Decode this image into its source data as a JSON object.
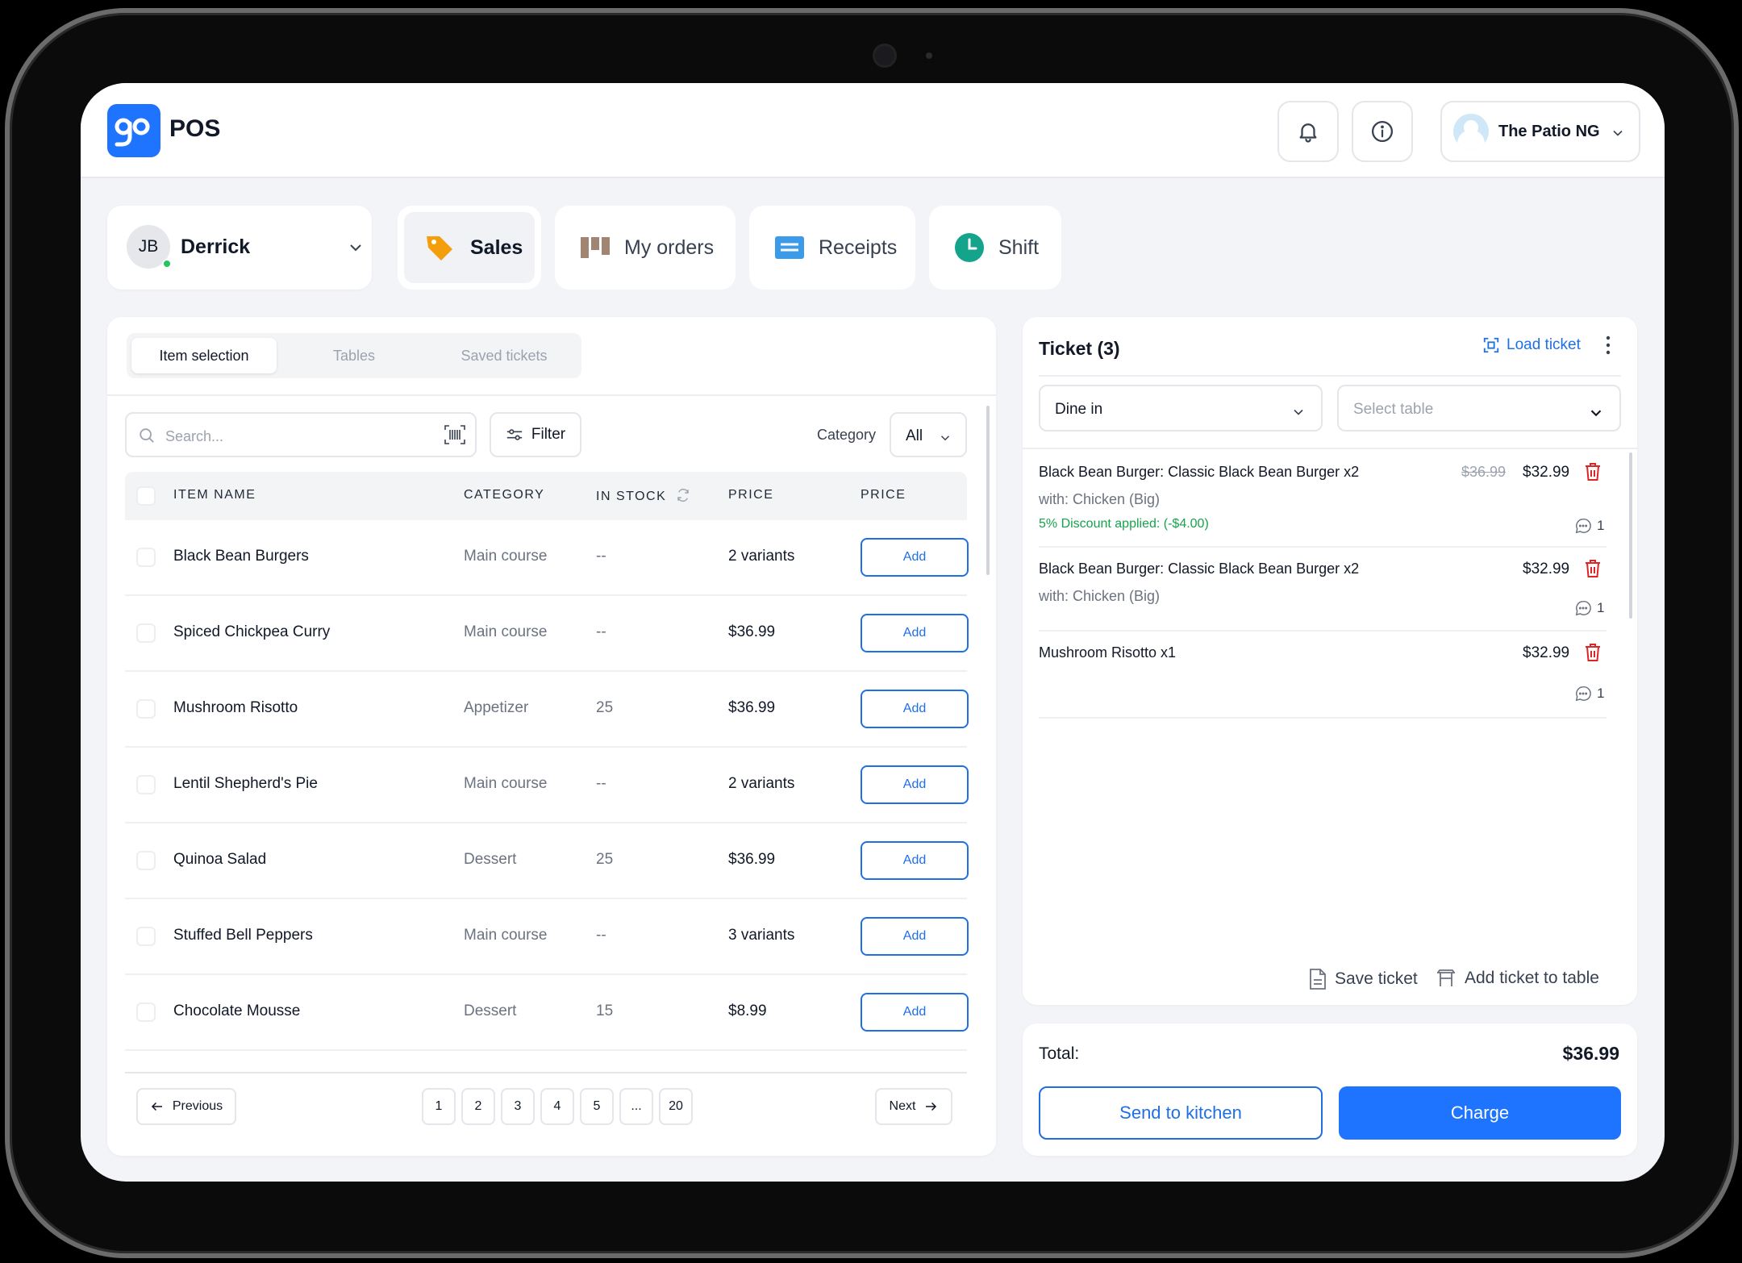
{
  "app": {
    "brand": "POS"
  },
  "header": {
    "venue": "The Patio NG"
  },
  "user": {
    "initials": "JB",
    "name": "Derrick"
  },
  "nav": [
    {
      "label": "Sales",
      "icon": "tag-icon"
    },
    {
      "label": "My orders",
      "icon": "orders-icon"
    },
    {
      "label": "Receipts",
      "icon": "receipt-icon"
    },
    {
      "label": "Shift",
      "icon": "clock-icon"
    }
  ],
  "tabs": [
    "Item selection",
    "Tables",
    "Saved tickets"
  ],
  "search": {
    "placeholder": "Search..."
  },
  "filter": {
    "label": "Filter"
  },
  "category": {
    "label": "Category",
    "value": "All"
  },
  "table": {
    "headers": [
      "ITEM NAME",
      "CATEGORY",
      "IN STOCK",
      "PRICE",
      "PRICE"
    ],
    "add_label": "Add",
    "rows": [
      {
        "name": "Black Bean Burgers",
        "category": "Main course",
        "stock": "--",
        "price": "2 variants"
      },
      {
        "name": "Spiced Chickpea Curry",
        "category": "Main course",
        "stock": "--",
        "price": "$36.99"
      },
      {
        "name": "Mushroom Risotto",
        "category": "Appetizer",
        "stock": "25",
        "price": "$36.99"
      },
      {
        "name": "Lentil Shepherd's Pie",
        "category": "Main course",
        "stock": "--",
        "price": "2 variants"
      },
      {
        "name": "Quinoa Salad",
        "category": "Dessert",
        "stock": "25",
        "price": "$36.99"
      },
      {
        "name": "Stuffed Bell Peppers",
        "category": "Main course",
        "stock": "--",
        "price": "3 variants"
      },
      {
        "name": "Chocolate Mousse",
        "category": "Dessert",
        "stock": "15",
        "price": "$8.99"
      }
    ]
  },
  "pagination": {
    "previous": "Previous",
    "next": "Next",
    "pages": [
      "1",
      "2",
      "3",
      "4",
      "5",
      "...",
      "20"
    ]
  },
  "ticket": {
    "title": "Ticket (3)",
    "load_label": "Load ticket",
    "order_type": "Dine in",
    "table_placeholder": "Select table",
    "items": [
      {
        "name": "Black Bean Burger: Classic Black Bean Burger x2",
        "with": "with: Chicken (Big)",
        "discount": "5% Discount applied: (-$4.00)",
        "old_price": "$36.99",
        "price": "$32.99",
        "notes": "1"
      },
      {
        "name": "Black Bean Burger: Classic Black Bean Burger x2",
        "with": "with: Chicken (Big)",
        "price": "$32.99",
        "notes": "1"
      },
      {
        "name": "Mushroom Risotto x1",
        "price": "$32.99",
        "notes": "1"
      }
    ],
    "save_label": "Save ticket",
    "add_table_label": "Add ticket to table"
  },
  "totals": {
    "label": "Total:",
    "value": "$36.99"
  },
  "actions": {
    "send": "Send to kitchen",
    "charge": "Charge"
  },
  "colors": {
    "accent": "#1f74ff",
    "discount": "#16a34a",
    "danger": "#dc2626"
  }
}
